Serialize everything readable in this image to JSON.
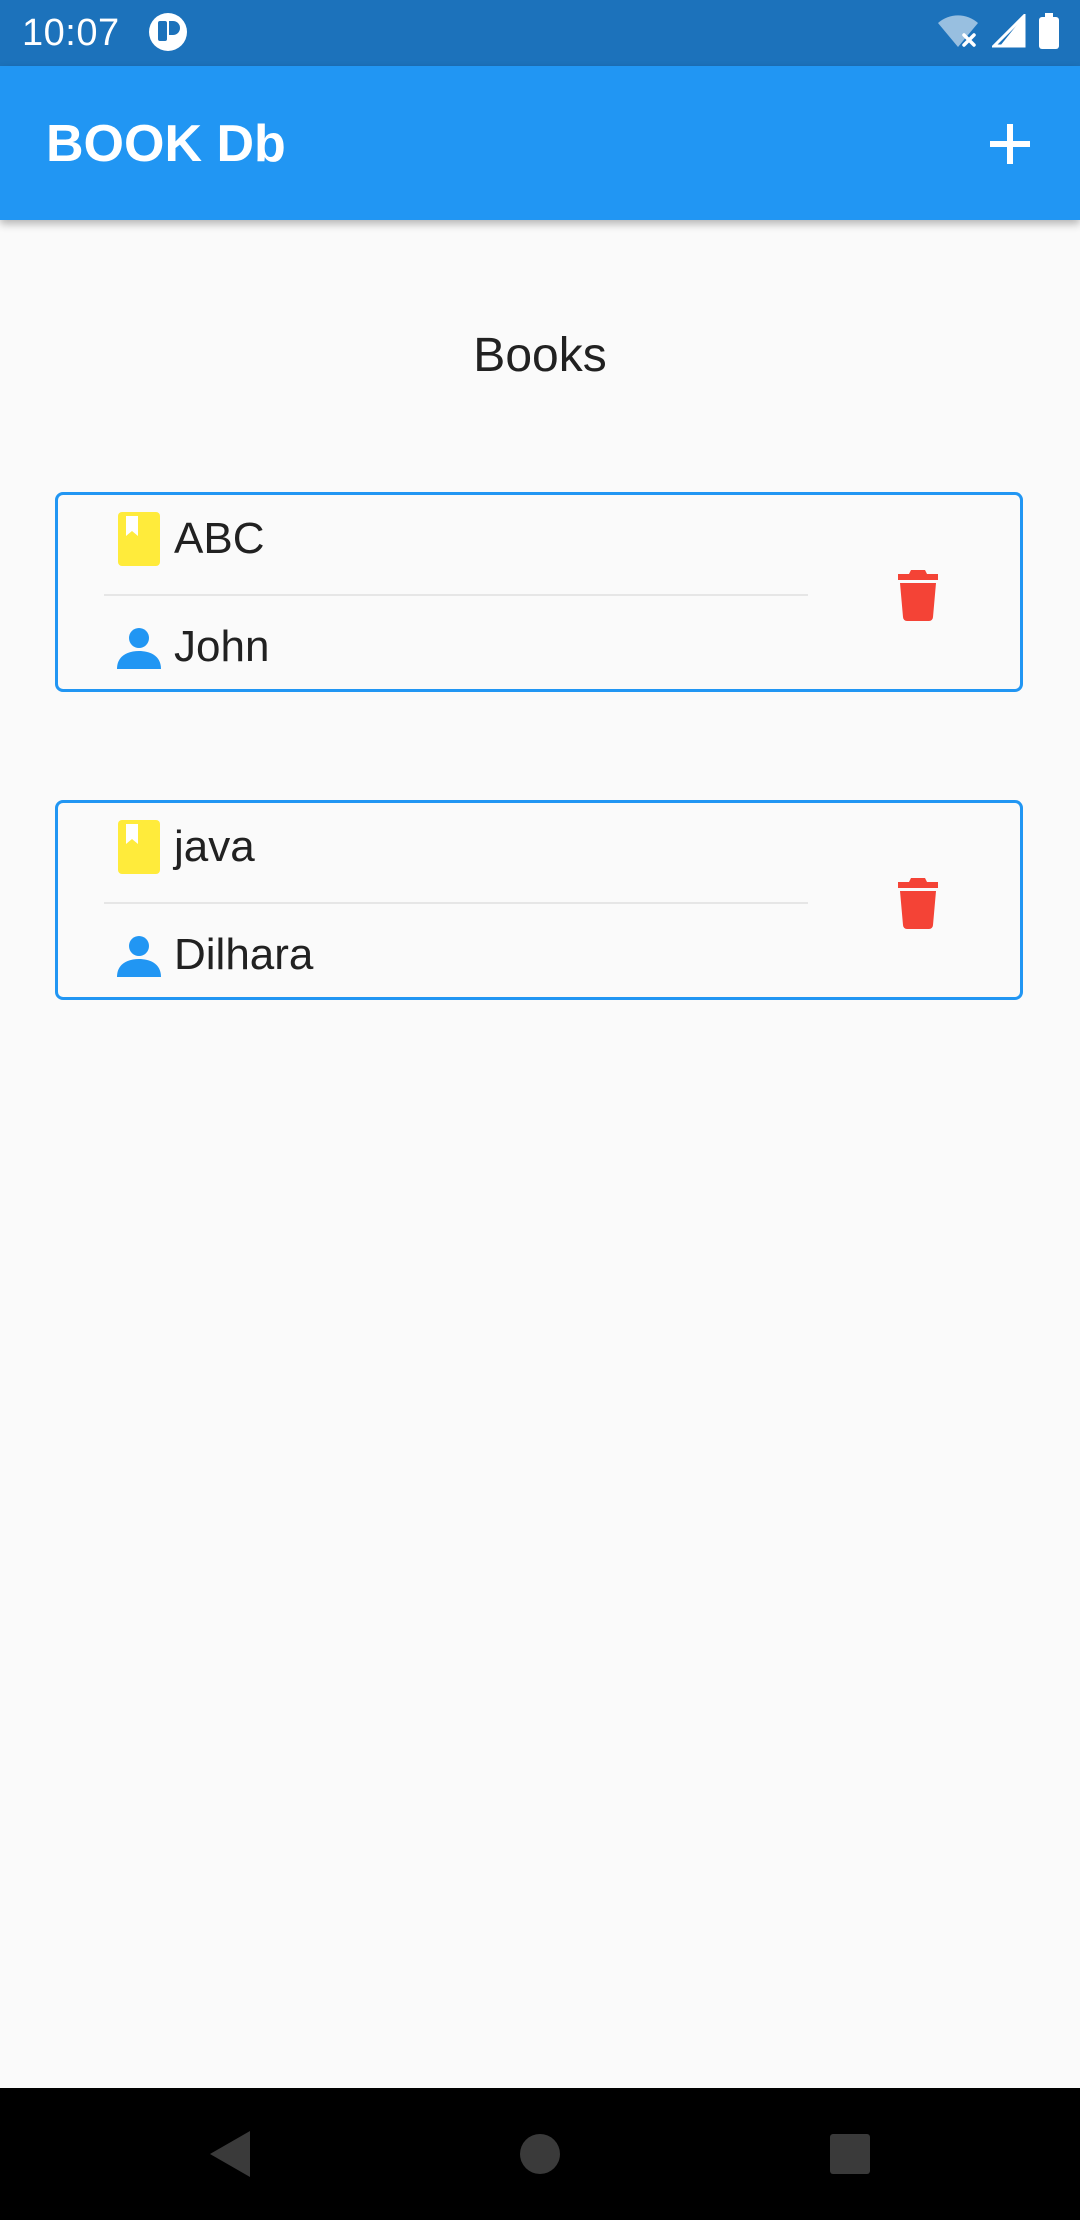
{
  "status_bar": {
    "time": "10:07",
    "icons": [
      "app-notification-icon",
      "wifi-off-icon",
      "cell-signal-icon",
      "battery-icon"
    ]
  },
  "app_bar": {
    "title": "BOOK Db",
    "actions": [
      "add-icon"
    ]
  },
  "page": {
    "heading": "Books"
  },
  "books": [
    {
      "title": "ABC",
      "author": "John"
    },
    {
      "title": "java",
      "author": "Dilhara"
    }
  ],
  "icons": {
    "book": "book-icon",
    "author": "person-icon",
    "delete": "delete-icon"
  },
  "colors": {
    "status_bar": "#1c72bb",
    "app_bar": "#2196f3",
    "card_border": "#2196f3",
    "book_icon": "#ffeb3b",
    "person_icon": "#2196f3",
    "delete_icon": "#f44336",
    "background": "#fafafa",
    "nav_bar": "#000000"
  },
  "nav_bar": {
    "buttons": [
      "back",
      "home",
      "recents"
    ]
  }
}
